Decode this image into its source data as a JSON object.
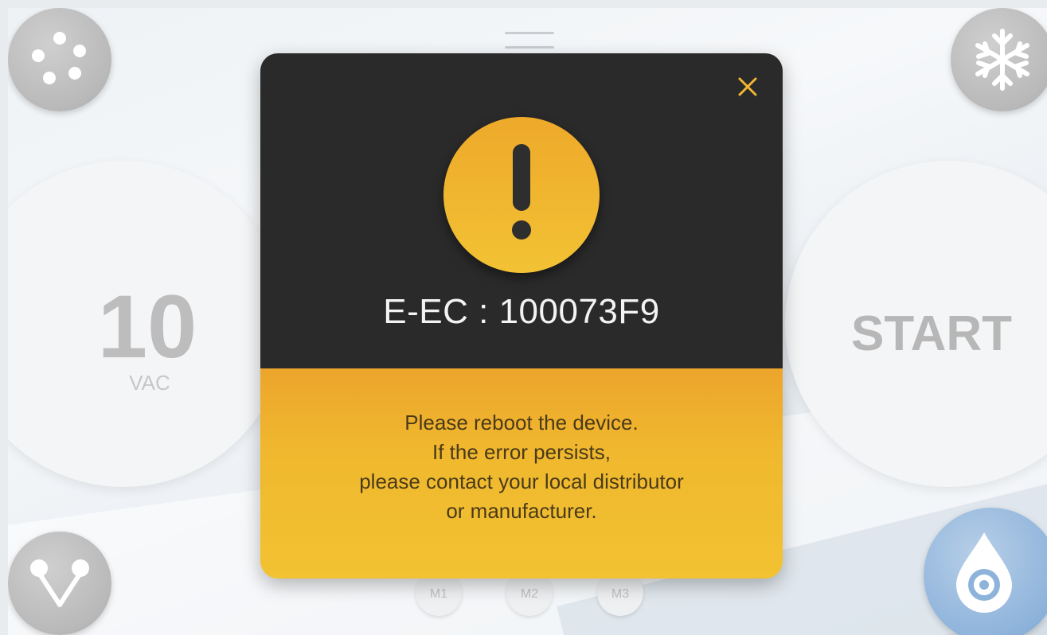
{
  "vacuum": {
    "value": "10",
    "unit": "VAC"
  },
  "start": {
    "label": "START"
  },
  "memory_buttons": [
    {
      "label": "M1"
    },
    {
      "label": "M2"
    },
    {
      "label": "M3"
    }
  ],
  "icons": {
    "top_left": "dots-menu-icon",
    "top_right": "snowflake-icon",
    "bottom_left": "branch-icon",
    "bottom_right": "water-drop-icon",
    "modal_close": "close-icon",
    "modal_alert": "exclamation-icon"
  },
  "error_dialog": {
    "code": "E-EC : 100073F9",
    "message_lines": [
      "Please reboot the device.",
      "If the error persists,",
      "please contact your local distributor",
      "or manufacturer."
    ]
  },
  "colors": {
    "dialog_dark": "#2a2a2a",
    "dialog_accent": "#f0b82e",
    "close_icon": "#f2b632",
    "water_button": "#8eb3db",
    "grey_button": "#b9b9b9"
  }
}
